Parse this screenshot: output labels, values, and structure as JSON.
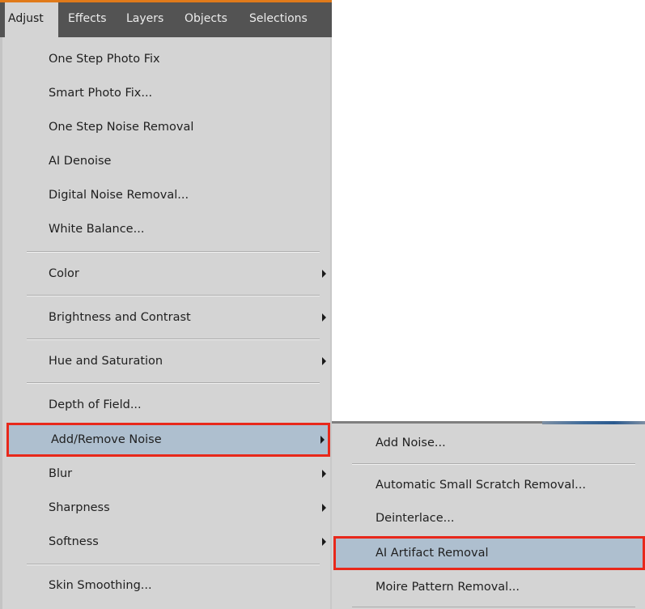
{
  "menubar": {
    "items": [
      {
        "label": "Adjust"
      },
      {
        "label": "Effects"
      },
      {
        "label": "Layers"
      },
      {
        "label": "Objects"
      },
      {
        "label": "Selections"
      }
    ]
  },
  "adjust_menu": {
    "items": [
      {
        "label": "One Step Photo Fix"
      },
      {
        "label": "Smart Photo Fix..."
      },
      {
        "label": "One Step Noise Removal"
      },
      {
        "label": "AI Denoise"
      },
      {
        "label": "Digital Noise Removal..."
      },
      {
        "label": "White Balance..."
      },
      {
        "label": "Color"
      },
      {
        "label": "Brightness and Contrast"
      },
      {
        "label": "Hue and Saturation"
      },
      {
        "label": "Depth of Field..."
      },
      {
        "label": "Add/Remove Noise"
      },
      {
        "label": "Blur"
      },
      {
        "label": "Sharpness"
      },
      {
        "label": "Softness"
      },
      {
        "label": "Skin Smoothing..."
      }
    ]
  },
  "noise_submenu": {
    "items": [
      {
        "label": "Add Noise..."
      },
      {
        "label": "Automatic Small Scratch Removal..."
      },
      {
        "label": "Deinterlace..."
      },
      {
        "label": "AI Artifact Removal"
      },
      {
        "label": "Moire Pattern Removal..."
      }
    ]
  },
  "colors": {
    "highlight_border": "#e8281b",
    "highlight_fill": "#aebfcf",
    "menubar_bg": "#535353",
    "menu_bg": "#d4d4d4"
  }
}
